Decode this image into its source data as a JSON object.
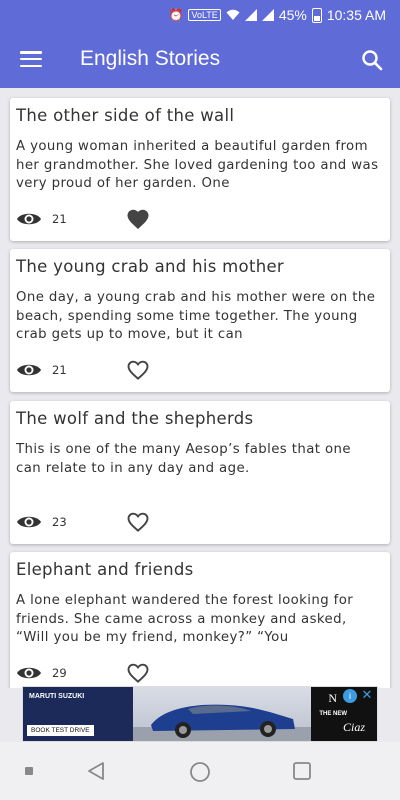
{
  "status_bar": {
    "volte": "VoLTE",
    "battery_percent": "45%",
    "time": "10:35 AM"
  },
  "app_bar": {
    "title": "English Stories",
    "menu_icon": "hamburger-menu-icon",
    "search_icon": "search-icon"
  },
  "colors": {
    "primary": "#5f6bd6",
    "background": "#e9e9ee",
    "card": "#ffffff",
    "text": "#333333"
  },
  "stories": [
    {
      "title": "The other side of the wall",
      "excerpt": "A young woman inherited a beautiful garden from her grandmother. She loved gardening too and was very proud of her garden. One",
      "views": "21",
      "favorited": true
    },
    {
      "title": "The young crab and his mother",
      "excerpt": "One day, a young crab and his mother were on the beach, spending some time together. The young crab gets up to move, but it can",
      "views": "21",
      "favorited": false
    },
    {
      "title": "The wolf and the shepherds",
      "excerpt": "This is one of the many Aesop’s fables that one can relate to in any day and age.",
      "views": "23",
      "favorited": false
    },
    {
      "title": "Elephant and friends",
      "excerpt": "A lone elephant wandered the forest looking for friends. She came across a monkey and asked, “Will you be my friend, monkey?” “You",
      "views": "29",
      "favorited": false
    }
  ],
  "ad": {
    "brand": "MARUTI SUZUKI",
    "cta": "BOOK TEST DRIVE",
    "headline": "THE NEW",
    "model": "Ciaz",
    "n_mark": "N",
    "info": "i",
    "close": "✕"
  },
  "nav_bar": {
    "icons": [
      "recents-dot-icon",
      "back-icon",
      "home-icon",
      "overview-icon"
    ]
  }
}
